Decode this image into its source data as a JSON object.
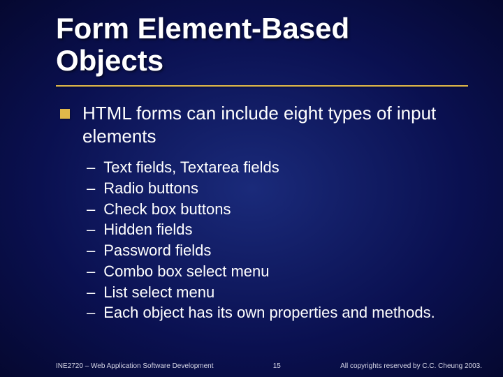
{
  "title_line1": "Form Element-Based",
  "title_line2": "Objects",
  "bullet1": "HTML forms can include eight types of input elements",
  "sub_items": [
    "Text fields, Textarea fields",
    "Radio buttons",
    "Check box buttons",
    "Hidden fields",
    "Password fields",
    "Combo box select menu",
    "List select menu",
    "Each object has its own properties and methods."
  ],
  "footer": {
    "left": "INE2720 – Web Application Software Development",
    "center": "15",
    "right": "All copyrights reserved by C.C. Cheung 2003."
  }
}
